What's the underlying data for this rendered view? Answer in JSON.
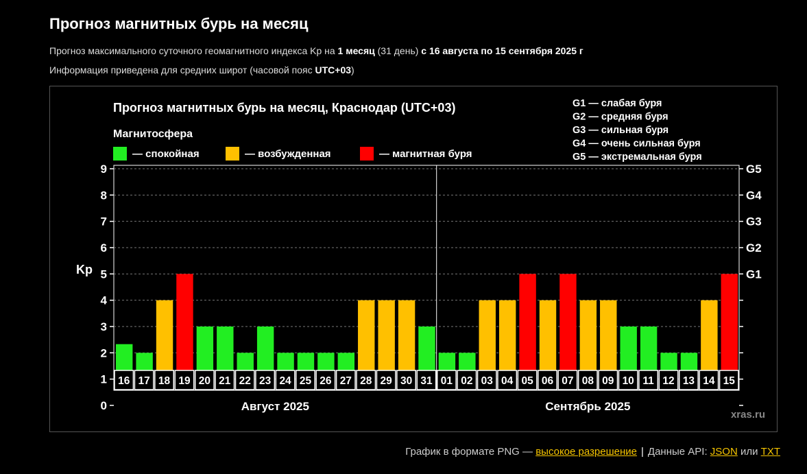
{
  "header": {
    "title": "Прогноз магнитных бурь на месяц",
    "line1": {
      "prefix": "Прогноз максимального суточного геомагнитного индекса Kp на ",
      "bold1": "1 месяц",
      "mid": " (31 день) ",
      "bold2": "с 16 августа по 15 сентября 2025 г"
    },
    "line2": {
      "prefix": "Информация приведена для средних широт (часовой пояс ",
      "bold": "UTC+03",
      "suffix": ")"
    }
  },
  "chart_data": {
    "type": "bar",
    "title": "Прогноз магнитных бурь на месяц, Краснодар (UTC+03)",
    "ylabel": "Kp",
    "ylim": [
      0,
      9
    ],
    "yticks": [
      "0",
      "1",
      "2",
      "3",
      "4",
      "5",
      "6",
      "7",
      "8",
      "9"
    ],
    "right_ticks": [
      {
        "value": 5,
        "label": "G1"
      },
      {
        "value": 6,
        "label": "G2"
      },
      {
        "value": 7,
        "label": "G3"
      },
      {
        "value": 8,
        "label": "G4"
      },
      {
        "value": 9,
        "label": "G5"
      }
    ],
    "legend_title": "Магнитосфера",
    "legend": [
      {
        "label": "— спокойная",
        "color": "#22ee22"
      },
      {
        "label": "— возбужденная",
        "color": "#ffc000"
      },
      {
        "label": "— магнитная буря",
        "color": "#ff0000"
      }
    ],
    "g_legend": [
      "G1 — слабая буря",
      "G2 — средняя буря",
      "G3 — сильная буря",
      "G4 — очень сильная буря",
      "G5 — экстремальная буря"
    ],
    "groups": [
      {
        "label": "Август 2025",
        "start": 0,
        "count": 16
      },
      {
        "label": "Сентябрь 2025",
        "start": 16,
        "count": 15
      }
    ],
    "categories": [
      "16",
      "17",
      "18",
      "19",
      "20",
      "21",
      "22",
      "23",
      "24",
      "25",
      "26",
      "27",
      "28",
      "29",
      "30",
      "31",
      "01",
      "02",
      "03",
      "04",
      "05",
      "06",
      "07",
      "08",
      "09",
      "10",
      "11",
      "12",
      "13",
      "14",
      "15"
    ],
    "values": [
      2.33,
      2,
      4,
      5,
      3,
      3,
      2,
      3,
      2,
      2,
      2,
      2,
      4,
      4,
      4,
      3,
      2,
      2,
      4,
      4,
      5,
      4,
      5,
      4,
      4,
      3,
      3,
      2,
      2,
      4,
      5
    ],
    "colors": {
      "quiet": "#22ee22",
      "active": "#ffc000",
      "storm": "#ff0000"
    },
    "watermark": "xras.ru",
    "grid": true
  },
  "footer": {
    "prefix": "График в формате PNG — ",
    "link_hires": "высокое разрешение",
    "sep": "|",
    "api_prefix": "Данные API: ",
    "link_json": "JSON",
    "or": " или ",
    "link_txt": "TXT"
  }
}
